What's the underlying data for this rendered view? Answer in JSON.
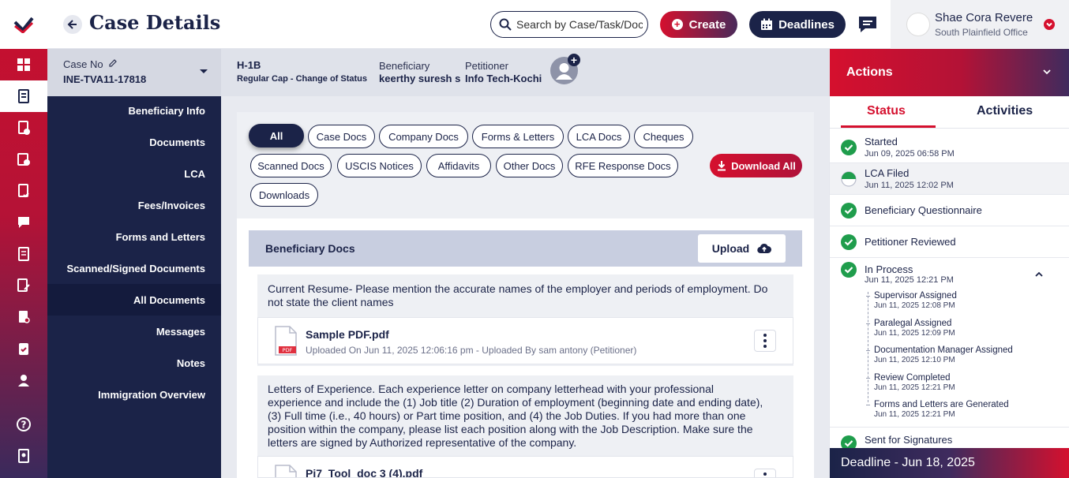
{
  "header": {
    "title": "Case Details",
    "search_placeholder": "Search by Case/Task/Document",
    "create_label": "Create",
    "deadlines_label": "Deadlines",
    "user_name": "Shae Cora Revere",
    "user_office": "South Plainfield Office"
  },
  "case": {
    "case_no_label": "Case No",
    "case_no": "INE-TVA11-17818",
    "visa_type": "H-1B",
    "visa_sub": "Regular Cap - Change of Status",
    "beneficiary_label": "Beneficiary",
    "beneficiary": "keerthy suresh s",
    "petitioner_label": "Petitioner",
    "petitioner": "Info Tech-Kochi"
  },
  "sidenav": {
    "items": [
      {
        "label": "Beneficiary Info"
      },
      {
        "label": "Documents"
      },
      {
        "label": "LCA"
      },
      {
        "label": "Fees/Invoices"
      },
      {
        "label": "Forms and Letters"
      },
      {
        "label": "Scanned/Signed Documents"
      },
      {
        "label": "All Documents"
      },
      {
        "label": "Messages"
      },
      {
        "label": "Notes"
      },
      {
        "label": "Immigration Overview"
      }
    ]
  },
  "filters": {
    "chips": [
      "All",
      "Case Docs",
      "Company Docs",
      "Forms & Letters",
      "LCA Docs",
      "Cheques",
      "Scanned Docs",
      "USCIS Notices",
      "Affidavits",
      "Other Docs",
      "RFE Response Docs",
      "Downloads"
    ],
    "download_all": "Download All"
  },
  "panel": {
    "title": "Beneficiary Docs",
    "upload_label": "Upload",
    "requirements": [
      {
        "text_lines": [
          "Current Resume- Please mention the accurate names of the employer and periods of employment. Do",
          "not state the client names"
        ],
        "file_name": "Sample PDF.pdf",
        "file_meta": "Uploaded On Jun 11, 2025 12:06:16 pm - Uploaded By sam antony (Petitioner)"
      },
      {
        "text_lines": [
          "Letters of Experience. Each experience letter on company letterhead with your professional",
          "experience and include the (1) Job title (2) Duration of employment (beginning date and ending date),",
          "(3) Full time (i.e., 40 hours) or Part time position, and (4) the Job Duties. If you had more than one",
          "position within the company, please list each position along with the Job Description. Make sure the",
          "letters are signed by Authorized representative of the company."
        ],
        "file_name": "Pi7_Tool_doc 3 (4).pdf"
      }
    ]
  },
  "actions": {
    "title": "Actions",
    "tab_status": "Status",
    "tab_activities": "Activities",
    "statuses": [
      {
        "name": "Started",
        "date": "Jun 09, 2025 06:58 PM",
        "state": "done"
      },
      {
        "name": "LCA Filed",
        "date": "Jun 11, 2025 12:02 PM",
        "state": "partial"
      },
      {
        "name": "Beneficiary Questionnaire",
        "state": "done"
      },
      {
        "name": "Petitioner Reviewed",
        "state": "done"
      },
      {
        "name": "In Process",
        "date": "Jun 11, 2025 12:21 PM",
        "state": "done"
      },
      {
        "name": "Sent for Signatures",
        "state": "done"
      }
    ],
    "sub_steps": [
      {
        "name": "Supervisor Assigned",
        "date": "Jun 11, 2025 12:08 PM"
      },
      {
        "name": "Paralegal Assigned",
        "date": "Jun 11, 2025 12:09 PM"
      },
      {
        "name": "Documentation Manager Assigned",
        "date": "Jun 11, 2025 12:10 PM"
      },
      {
        "name": "Review Completed",
        "date": "Jun 11, 2025 12:21 PM"
      },
      {
        "name": "Forms and Letters are Generated",
        "date": "Jun 11, 2025 12:21 PM"
      }
    ],
    "deadline": "Deadline - Jun 18, 2025"
  },
  "colors": {
    "brand_red": "#d5102e",
    "brand_navy": "#1b2348",
    "done_green": "#1f9d4c"
  },
  "icons": {
    "rail": [
      "dashboard-icon",
      "case-icon",
      "task-icon",
      "fees-icon",
      "checklist-icon",
      "message-icon",
      "document-icon",
      "edit-document-icon",
      "report-icon",
      "clipboard-icon",
      "contact-icon",
      "help-icon",
      "guide-icon"
    ]
  }
}
